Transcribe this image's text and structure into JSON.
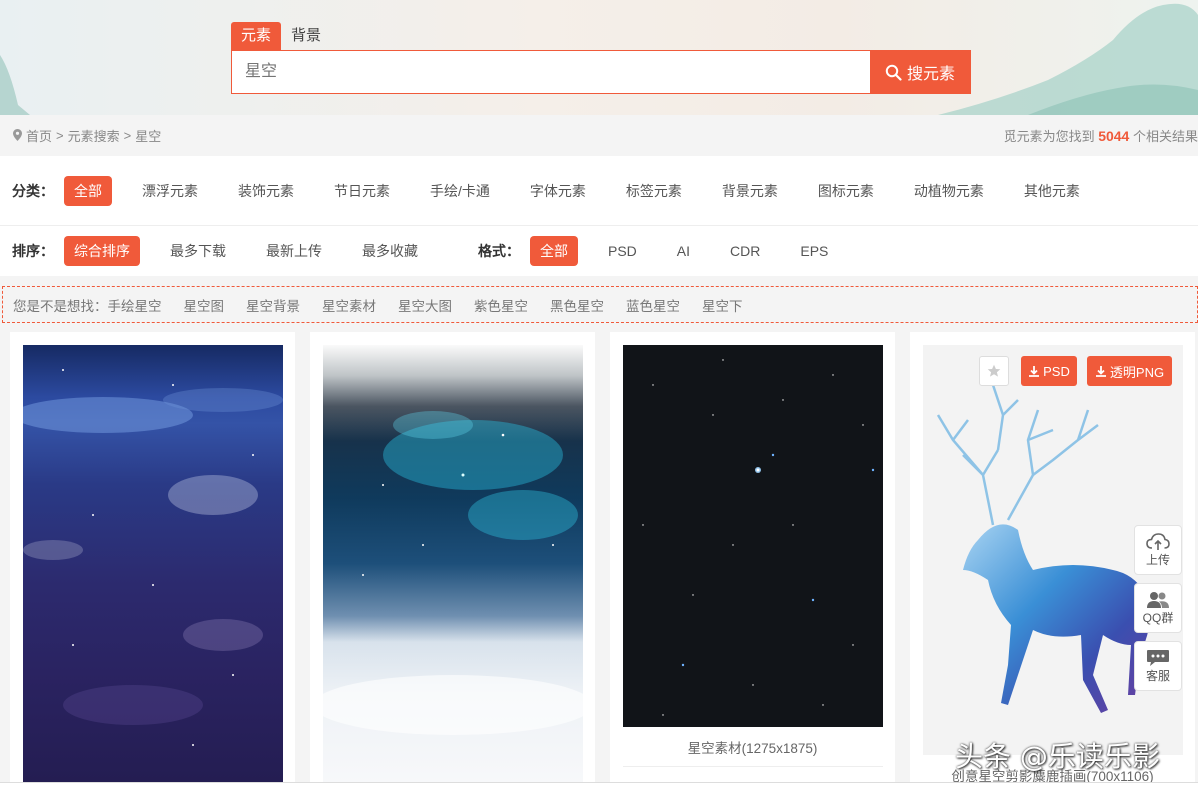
{
  "search": {
    "tabs": [
      "元素",
      "背景"
    ],
    "active_tab": 0,
    "placeholder": "星空",
    "button_label": "搜元素"
  },
  "breadcrumb": {
    "items": [
      "首页",
      "元素搜索",
      "星空"
    ],
    "separator": ">"
  },
  "result": {
    "prefix": "觅元素为您找到",
    "count": "5044",
    "suffix": "个相关结果"
  },
  "category": {
    "label": "分类：",
    "options": [
      "全部",
      "漂浮元素",
      "装饰元素",
      "节日元素",
      "手绘/卡通",
      "字体元素",
      "标签元素",
      "背景元素",
      "图标元素",
      "动植物元素",
      "其他元素"
    ],
    "active": 0
  },
  "sort": {
    "label": "排序：",
    "options": [
      "综合排序",
      "最多下载",
      "最新上传",
      "最多收藏"
    ],
    "active": 0
  },
  "format": {
    "label": "格式：",
    "options": [
      "全部",
      "PSD",
      "AI",
      "CDR",
      "EPS"
    ],
    "active": 0
  },
  "suggest": {
    "label": "您是不是想找：",
    "items": [
      "手绘星空",
      "星空图",
      "星空背景",
      "星空素材",
      "星空大图",
      "紫色星空",
      "黑色星空",
      "蓝色星空",
      "星空下"
    ]
  },
  "cards": [
    {
      "caption": ""
    },
    {
      "caption": ""
    },
    {
      "caption": "星空素材(1275x1875)"
    },
    {
      "caption": "创意星空剪影麋鹿插画(700x1106)",
      "psd_label": "PSD",
      "png_label": "透明PNG"
    }
  ],
  "side_tools": [
    "上传",
    "QQ群",
    "客服"
  ],
  "watermark": "头条 @乐读乐影",
  "colors": {
    "accent": "#f05a3a",
    "page_bg": "#f4f4f4"
  },
  "icons": [
    "location-icon",
    "search-icon",
    "star-icon",
    "download-icon",
    "upload-cloud-icon",
    "qq-group-icon",
    "chat-icon"
  ]
}
